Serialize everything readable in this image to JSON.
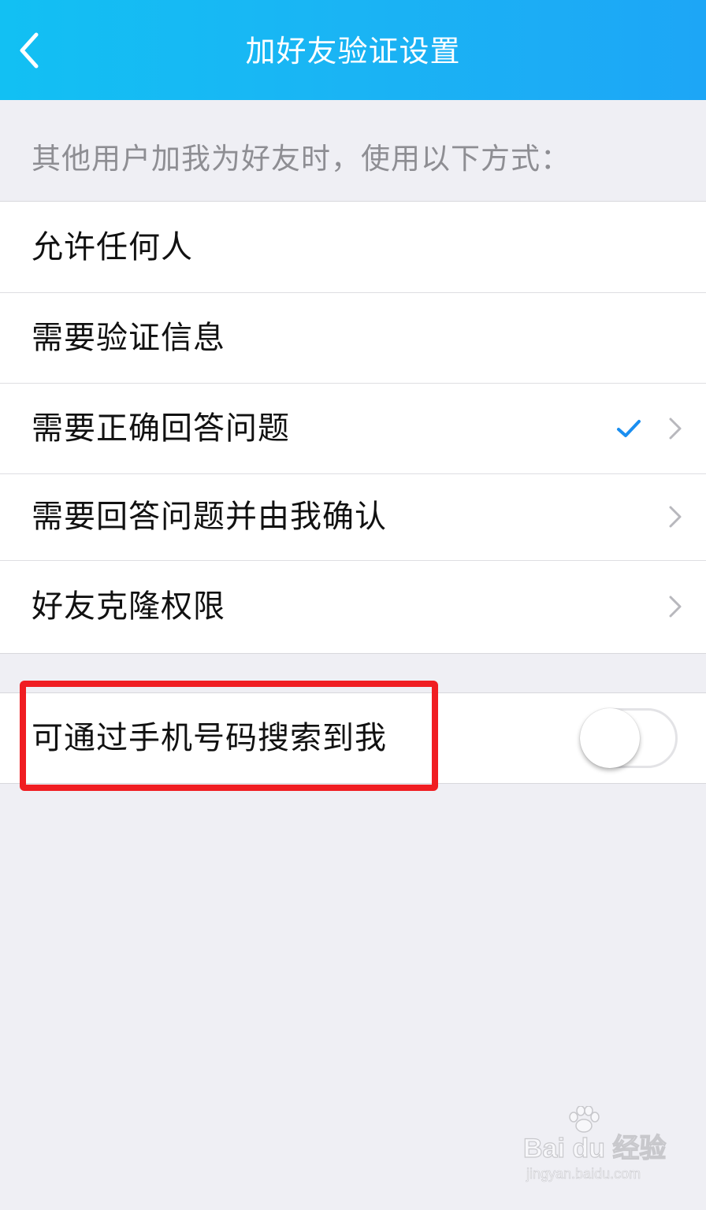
{
  "header": {
    "title": "加好友验证设置",
    "back_icon": "chevron-left-icon"
  },
  "section_caption": "其他用户加我为好友时，使用以下方式：",
  "options": [
    {
      "label": "允许任何人",
      "selected": false,
      "has_chevron": false
    },
    {
      "label": "需要验证信息",
      "selected": false,
      "has_chevron": false
    },
    {
      "label": "需要正确回答问题",
      "selected": true,
      "has_chevron": true
    },
    {
      "label": "需要回答问题并由我确认",
      "selected": false,
      "has_chevron": true
    },
    {
      "label": "好友克隆权限",
      "selected": false,
      "has_chevron": true
    }
  ],
  "phone_search": {
    "label": "可通过手机号码搜索到我",
    "enabled": false
  },
  "colors": {
    "header_gradient_start": "#12c0f3",
    "header_gradient_end": "#1da6f6",
    "check": "#1a8ef0",
    "highlight_box": "#f01d22",
    "page_background": "#efeff4"
  },
  "watermark": {
    "brand": "Bai du 经验",
    "url": "jingyan.baidu.com"
  }
}
